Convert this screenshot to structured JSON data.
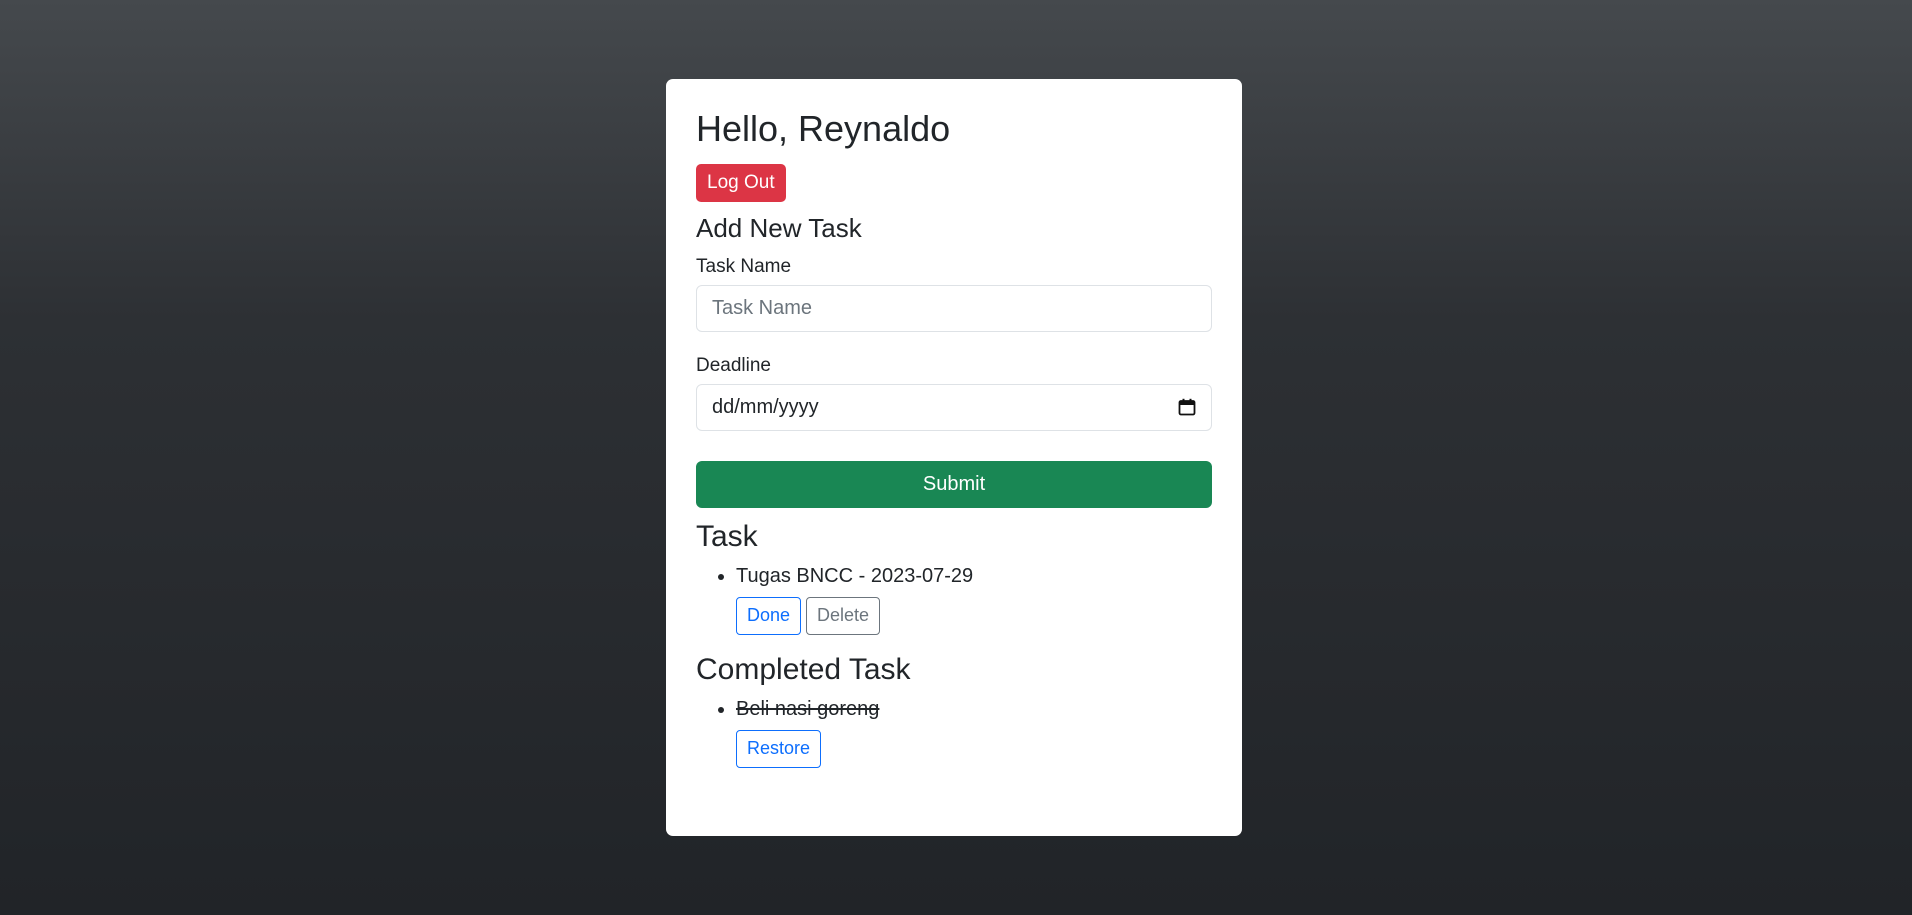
{
  "greeting": "Hello, Reynaldo",
  "logout_label": "Log Out",
  "add_task": {
    "title": "Add New Task",
    "task_name_label": "Task Name",
    "task_name_placeholder": "Task Name",
    "task_name_value": "",
    "deadline_label": "Deadline",
    "deadline_placeholder": "dd/mm/yyyy",
    "submit_label": "Submit"
  },
  "tasks": {
    "title": "Task",
    "items": [
      {
        "text": "Tugas BNCC - 2023-07-29",
        "done_label": "Done",
        "delete_label": "Delete"
      }
    ]
  },
  "completed": {
    "title": "Completed Task",
    "items": [
      {
        "text": "Beli nasi goreng",
        "restore_label": "Restore"
      }
    ]
  },
  "icons": {
    "calendar": "calendar-icon"
  },
  "colors": {
    "danger": "#dc3545",
    "success": "#198754",
    "primary": "#0d6efd",
    "secondary": "#6c757d"
  }
}
